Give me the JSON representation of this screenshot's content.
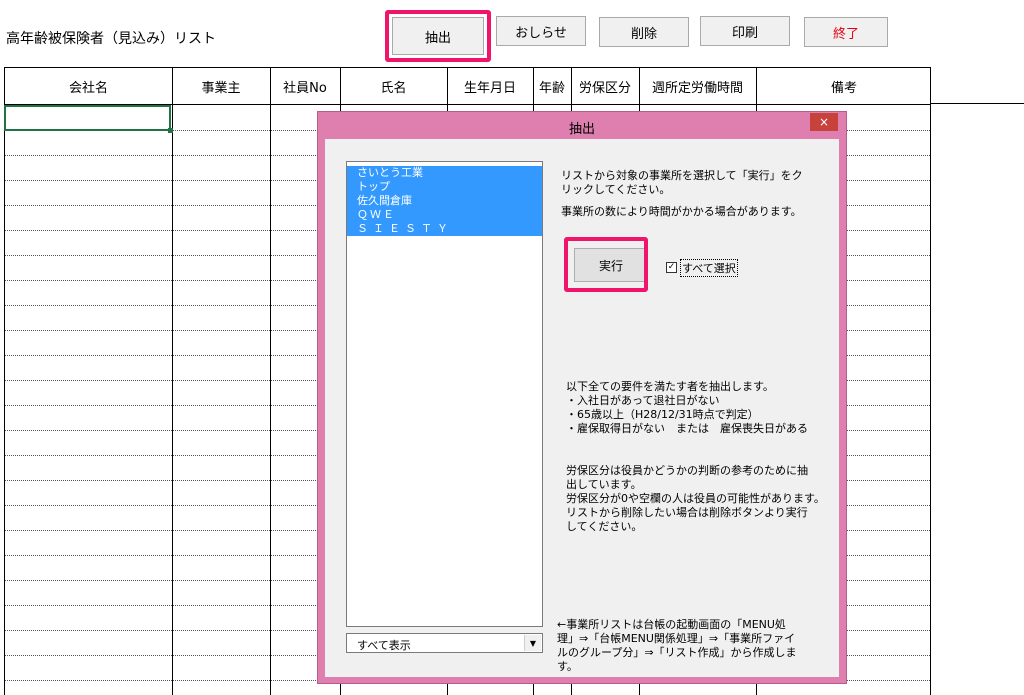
{
  "sheet": {
    "title": "高年齢被保険者（見込み）リスト"
  },
  "toolbar": {
    "extract_label": "抽出",
    "notice_label": "おしらせ",
    "delete_label": "削除",
    "print_label": "印刷",
    "exit_label": "終了"
  },
  "table": {
    "columns": [
      "会社名",
      "事業主",
      "社員No",
      "氏名",
      "生年月日",
      "年齢",
      "労保区分",
      "週所定労働時間",
      "備考"
    ]
  },
  "dialog": {
    "title": "抽出",
    "close_label": "×",
    "list_items": [
      "さいとう工業",
      "トップ",
      "佐久間倉庫",
      "ＱＷＥ",
      "ＳＩＥＳＴＹ"
    ],
    "combo_value": "すべて表示",
    "instruction_1": "リストから対象の事業所を選択して「実行」をクリックしてください。",
    "instruction_2": "事業所の数により時間がかかる場合があります。",
    "execute_label": "実行",
    "select_all_label": "すべて選択",
    "select_all_checked": true,
    "conditions_heading": "以下全ての要件を満たす者を抽出します。",
    "condition_1": "・入社日があって退社日がない",
    "condition_2": "・65歳以上（H28/12/31時点で判定）",
    "condition_3": "・雇保取得日がない　または　雇保喪失日がある",
    "note_1": "労保区分は役員かどうかの判断の参考のために抽出しています。",
    "note_2": "労保区分が0や空欄の人は役員の可能性があります。",
    "note_3": "リストから削除したい場合は削除ボタンより実行してください。",
    "footer_note": "←事業所リストは台帳の起動画面の「MENU処理」⇒「台帳MENU関係処理」⇒「事業所ファイルのグループ分」⇒「リスト作成」から作成します。"
  },
  "colors": {
    "highlight": "#f0146a",
    "dialog_frame": "#df7fb0",
    "selection": "#3399ff",
    "exit_text": "#e60012"
  }
}
